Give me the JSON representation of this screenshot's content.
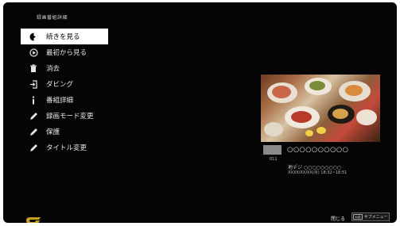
{
  "header": {
    "title": "録画番組詳細"
  },
  "menu": {
    "items": [
      {
        "label": "続きを見る",
        "icon": "resume-icon",
        "selected": true
      },
      {
        "label": "最初から見る",
        "icon": "play-icon",
        "selected": false
      },
      {
        "label": "消去",
        "icon": "trash-icon",
        "selected": false
      },
      {
        "label": "ダビング",
        "icon": "dubbing-icon",
        "selected": false
      },
      {
        "label": "番組詳細",
        "icon": "info-icon",
        "selected": false
      },
      {
        "label": "録画モード変更",
        "icon": "pencil-icon",
        "selected": false
      },
      {
        "label": "保護",
        "icon": "pencil-icon",
        "selected": false
      },
      {
        "label": "タイトル変更",
        "icon": "pencil-icon",
        "selected": false
      }
    ]
  },
  "program": {
    "title": "○○○○○○○○○○",
    "channel": "011",
    "station": "地デジ ○○○○○○○○○",
    "datetime": "XXXX/XX/XX(月) 18:32~18:51"
  },
  "footer": {
    "close_label": "閉じる",
    "submenu_key": "sub",
    "submenu_label": "サブメニュー"
  },
  "colors": {
    "background": "#050505",
    "selected_bg": "#ffffff",
    "logo": "#c8a21a"
  }
}
